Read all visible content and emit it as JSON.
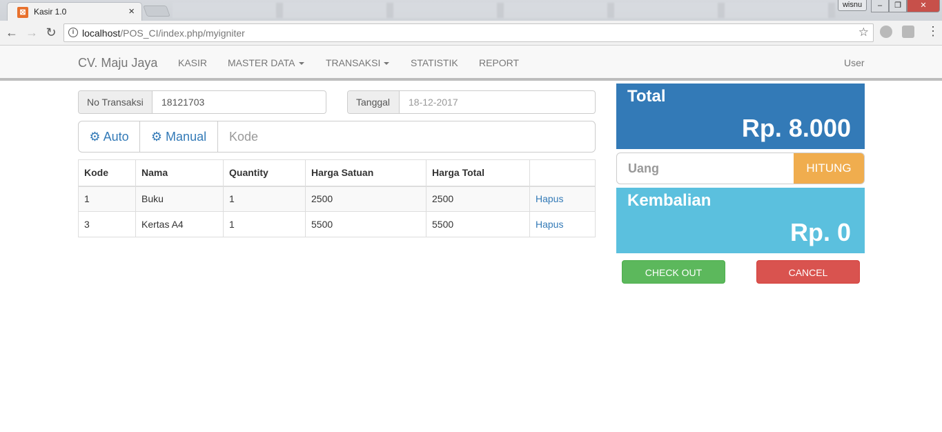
{
  "browser": {
    "tab_title": "Kasir 1.0",
    "tab_close": "×",
    "window_user": "wisnu",
    "window_min": "–",
    "window_max": "❐",
    "window_close": "✕",
    "url_host": "localhost",
    "url_path": "/POS_CI/index.php/myigniter"
  },
  "navbar": {
    "brand": "CV. Maju Jaya",
    "items": [
      {
        "label": "KASIR"
      },
      {
        "label": "MASTER DATA"
      },
      {
        "label": "TRANSAKSI"
      },
      {
        "label": "STATISTIK"
      },
      {
        "label": "REPORT"
      }
    ],
    "user": "User"
  },
  "form": {
    "no_transaksi_label": "No Transaksi",
    "no_transaksi_value": "18121703",
    "tanggal_label": "Tanggal",
    "tanggal_value": "18-12-2017",
    "auto_label": "Auto",
    "manual_label": "Manual",
    "kode_placeholder": "Kode"
  },
  "table": {
    "headers": [
      "Kode",
      "Nama",
      "Quantity",
      "Harga Satuan",
      "Harga Total",
      ""
    ],
    "rows": [
      {
        "kode": "1",
        "nama": "Buku",
        "qty": "1",
        "harga_satuan": "2500",
        "harga_total": "2500",
        "action": "Hapus"
      },
      {
        "kode": "3",
        "nama": "Kertas A4",
        "qty": "1",
        "harga_satuan": "5500",
        "harga_total": "5500",
        "action": "Hapus"
      }
    ]
  },
  "summary": {
    "total_label": "Total",
    "total_value": "Rp. 8.000",
    "uang_placeholder": "Uang",
    "hitung_label": "HITUNG",
    "kembalian_label": "Kembalian",
    "kembalian_value": "Rp. 0",
    "checkout_label": "CHECK OUT",
    "cancel_label": "CANCEL"
  },
  "colors": {
    "primary": "#337ab7",
    "info": "#5bc0de",
    "warning": "#f0ad4e",
    "success": "#5cb85c",
    "danger": "#d9534f"
  }
}
